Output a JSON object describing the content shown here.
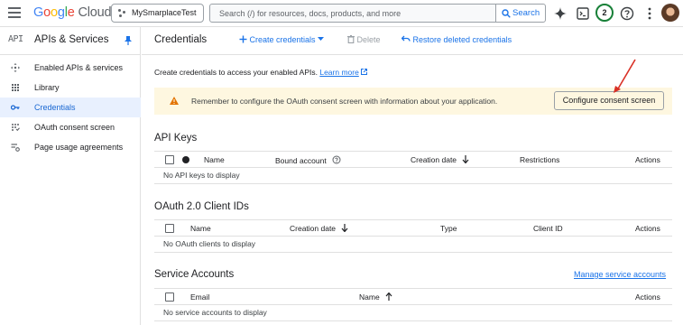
{
  "topbar": {
    "logo": {
      "g": "G",
      "o1": "o",
      "o2": "o",
      "g2": "g",
      "l": "l",
      "e": "e",
      "cloud": "Cloud"
    },
    "project_name": "MySmarplaceTest",
    "search_placeholder": "Search (/) for resources, docs, products, and more",
    "search_button": "Search",
    "notification_count": "2"
  },
  "sidebar": {
    "logo_text": "API",
    "title": "APIs & Services",
    "items": [
      {
        "label": "Enabled APIs & services",
        "icon": "diamond-arrows-icon"
      },
      {
        "label": "Library",
        "icon": "library-icon"
      },
      {
        "label": "Credentials",
        "icon": "key-icon",
        "active": true
      },
      {
        "label": "OAuth consent screen",
        "icon": "consent-icon"
      },
      {
        "label": "Page usage agreements",
        "icon": "settings-list-icon"
      }
    ]
  },
  "header": {
    "title": "Credentials",
    "create_label": "Create credentials",
    "delete_label": "Delete",
    "restore_label": "Restore deleted credentials"
  },
  "intro": {
    "text": "Create credentials to access your enabled APIs.",
    "learn_more": "Learn more"
  },
  "banner": {
    "text": "Remember to configure the OAuth consent screen with information about your application.",
    "button": "Configure consent screen"
  },
  "api_keys": {
    "title": "API Keys",
    "columns": [
      "Name",
      "Bound account",
      "Creation date",
      "Restrictions",
      "Actions"
    ],
    "empty": "No API keys to display"
  },
  "oauth_clients": {
    "title": "OAuth 2.0 Client IDs",
    "columns": [
      "Name",
      "Creation date",
      "Type",
      "Client ID",
      "Actions"
    ],
    "empty": "No OAuth clients to display"
  },
  "service_accounts": {
    "title": "Service Accounts",
    "manage_link": "Manage service accounts",
    "columns": [
      "Email",
      "Name",
      "Actions"
    ],
    "empty": "No service accounts to display"
  },
  "colors": {
    "accent": "#1a73e8",
    "active_bg": "#e8f0fe",
    "banner_bg": "#fef7e0",
    "warning": "#e37400",
    "annotation": "#d93025"
  }
}
